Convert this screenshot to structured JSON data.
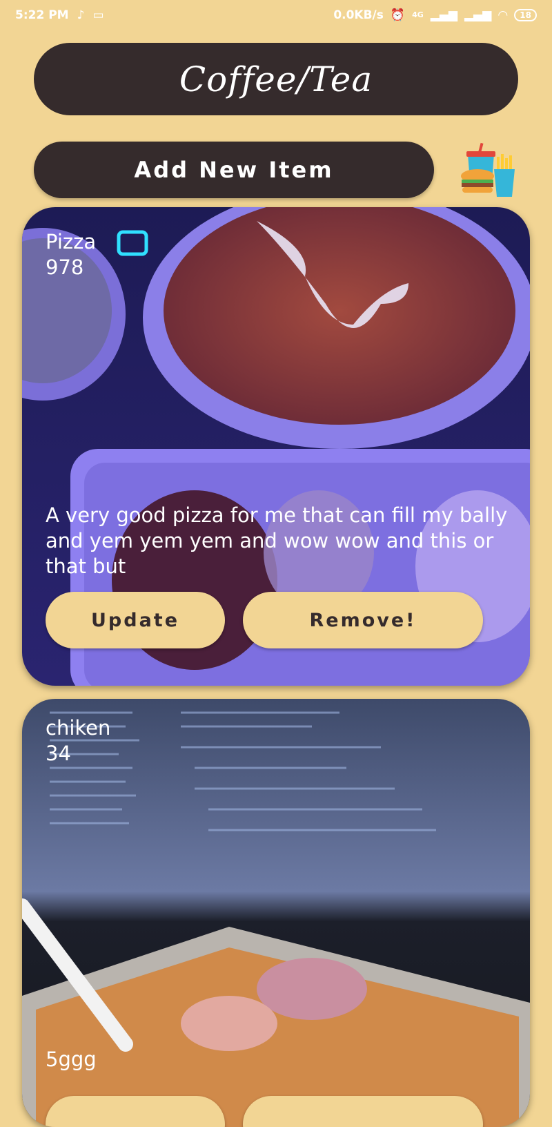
{
  "status_bar": {
    "time": "5:22 PM",
    "net_speed": "0.0KB/s",
    "network": "4G",
    "battery": "18"
  },
  "header": {
    "title": "Coffee/Tea"
  },
  "toolbar": {
    "add_label": "Add New Item"
  },
  "items": [
    {
      "name": "Pizza",
      "price": "978",
      "description": "A very good pizza for me that can fill my bally and yem yem yem and wow wow and this or that but",
      "update_label": "Update",
      "remove_label": "Remove!"
    },
    {
      "name": "chiken",
      "price": "34",
      "description": "5ggg"
    }
  ],
  "icons": {
    "music": "tiktok-icon",
    "screen": "cast-icon",
    "alarm": "alarm-icon",
    "wifi": "wifi-icon",
    "food": "fast-food-icon"
  },
  "colors": {
    "background": "#f2d594",
    "dark": "#352b2c"
  }
}
